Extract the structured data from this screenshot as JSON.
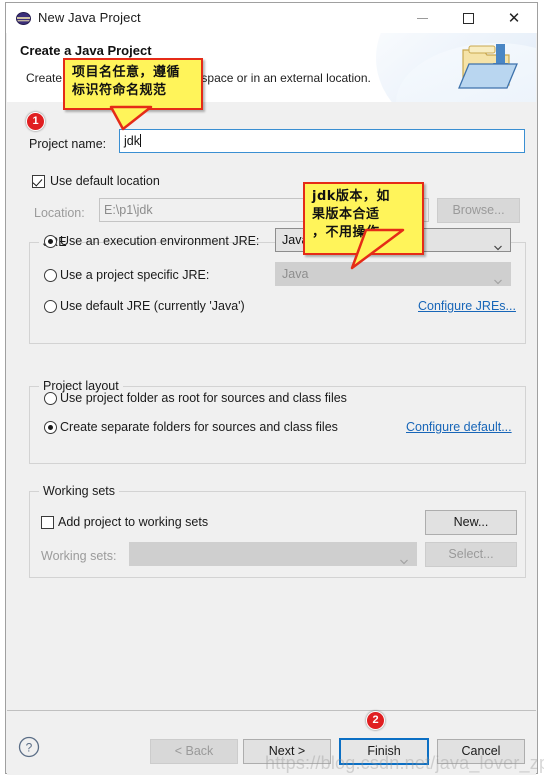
{
  "window": {
    "title": "New Java Project",
    "icon": "eclipse-sphere-icon",
    "controls": {
      "minimize": "—",
      "maximize": "□",
      "close": "✕"
    }
  },
  "banner": {
    "title": "Create a Java Project",
    "description": "Create a Java project in the workspace or in an external location.",
    "icon": "folder-with-arrow-icon"
  },
  "project_name": {
    "label": "Project name:",
    "value": "jdk",
    "placeholder": ""
  },
  "location": {
    "use_default_label": "Use default location",
    "use_default_checked": true,
    "label": "Location:",
    "value": "E:\\p1\\jdk",
    "browse_label": "Browse..."
  },
  "jre": {
    "group_title": "JRE",
    "options": [
      {
        "label": "Use an execution environment JRE:",
        "selected": true
      },
      {
        "label": "Use a project specific JRE:",
        "selected": false
      },
      {
        "label": "Use default JRE (currently 'Java')",
        "selected": false
      }
    ],
    "execution_env_value": "JavaSE-1.8",
    "specific_jre_value": "Java",
    "configure_link": "Configure JREs..."
  },
  "project_layout": {
    "group_title": "Project layout",
    "options": [
      {
        "label": "Use project folder as root for sources and class files",
        "selected": false
      },
      {
        "label": "Create separate folders for sources and class files",
        "selected": true
      }
    ],
    "configure_link": "Configure default..."
  },
  "working_sets": {
    "group_title": "Working sets",
    "add_label": "Add project to working sets",
    "add_checked": false,
    "label": "Working sets:",
    "value": "",
    "new_label": "New...",
    "select_label": "Select..."
  },
  "footer": {
    "help_icon": "question-mark-icon",
    "back_label": "< Back",
    "next_label": "Next >",
    "finish_label": "Finish",
    "cancel_label": "Cancel"
  },
  "annotations": {
    "badge_one": "1",
    "badge_two": "2",
    "callout_one": "项目名任意，遵循\n标识符命名规范",
    "callout_two": "jdk版本，如\n果版本合适\n，不用操作"
  },
  "watermark": "https://blog.csdn.net/java_lover_zpark",
  "colors": {
    "accent": "#0b6fc4",
    "link": "#1866b8",
    "callout_fill": "#fff45a",
    "callout_border": "#e52b17",
    "badge": "#e01f21"
  }
}
